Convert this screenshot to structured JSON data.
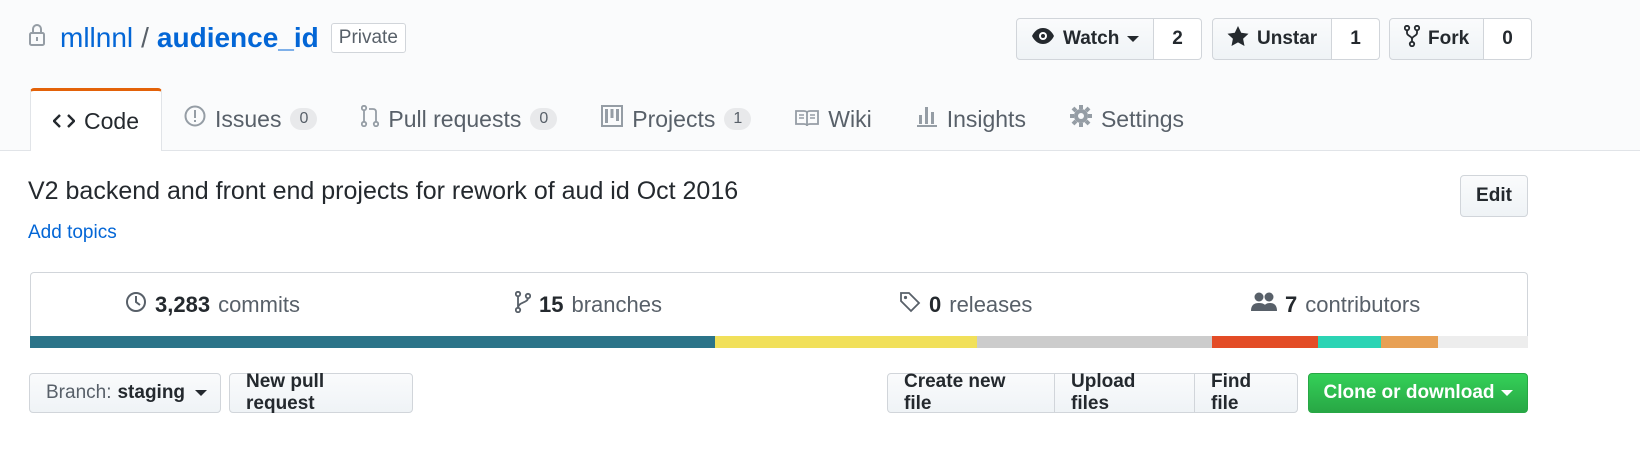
{
  "repo": {
    "owner": "mllnnl",
    "separator": "/",
    "name": "audience_id",
    "visibility": "Private"
  },
  "actions": [
    {
      "label": "Watch",
      "count": "2",
      "icon": "eye-icon"
    },
    {
      "label": "Unstar",
      "count": "1",
      "icon": "star-icon"
    },
    {
      "label": "Fork",
      "count": "0",
      "icon": "fork-icon"
    }
  ],
  "tabs": [
    {
      "label": "Code",
      "selected": true,
      "icon": "code-icon"
    },
    {
      "label": "Issues",
      "count": "0",
      "icon": "issue-icon"
    },
    {
      "label": "Pull requests",
      "count": "0",
      "icon": "pull-request-icon"
    },
    {
      "label": "Projects",
      "count": "1",
      "icon": "project-icon"
    },
    {
      "label": "Wiki",
      "icon": "book-icon"
    },
    {
      "label": "Insights",
      "icon": "graph-icon"
    },
    {
      "label": "Settings",
      "icon": "gear-icon"
    }
  ],
  "description": "V2 backend and front end projects for rework of aud id Oct 2016",
  "add_topics": "Add topics",
  "edit_label": "Edit",
  "summary": {
    "commits": {
      "count": "3,283",
      "label": "commits"
    },
    "branches": {
      "count": "15",
      "label": "branches"
    },
    "releases": {
      "count": "0",
      "releases_label": "releases",
      "label": "releases"
    },
    "contributors": {
      "count": "7",
      "label": "contributors"
    }
  },
  "languages": [
    {
      "color": "#2b7489",
      "share": 45.7
    },
    {
      "color": "#f1e05a",
      "share": 17.5
    },
    {
      "color": "#cccccc",
      "share": 15.7
    },
    {
      "color": "#e34c26",
      "share": 7.1
    },
    {
      "color": "#2bd4b4",
      "share": 4.2
    },
    {
      "color": "#e8a054",
      "share": 3.8
    },
    {
      "color": "#ededed",
      "share": 6.0
    }
  ],
  "file_nav": {
    "branch_prefix": "Branch:",
    "branch": "staging",
    "new_pr": "New pull request",
    "create_file": "Create new file",
    "upload": "Upload files",
    "find": "Find file",
    "clone": "Clone or download"
  }
}
